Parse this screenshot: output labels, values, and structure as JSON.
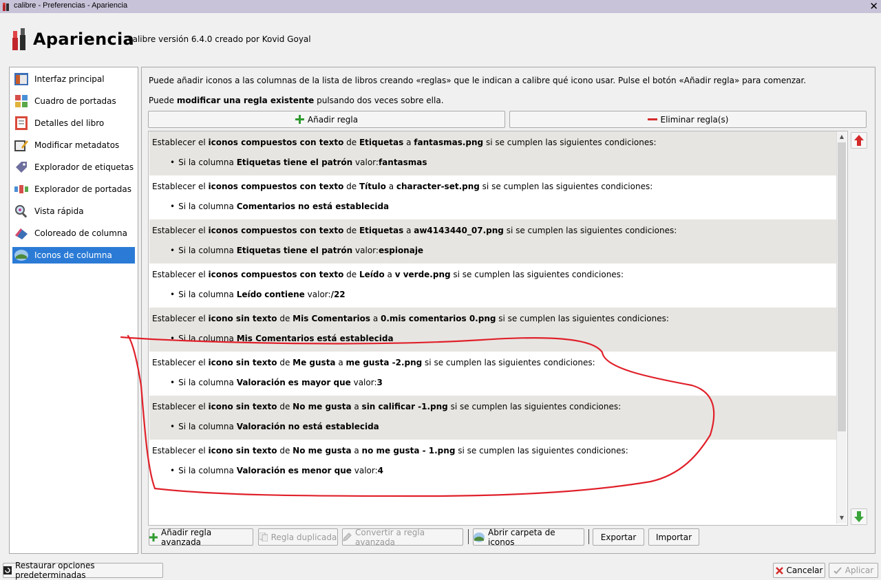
{
  "window": {
    "title": "calibre - Preferencias - Apariencia",
    "close_label": "✕"
  },
  "header": {
    "title": "Apariencia",
    "subtitle": "calibre versión 6.4.0 creado por Kovid Goyal"
  },
  "sidebar": {
    "items": [
      {
        "label": "Interfaz principal",
        "icon": "main-interface-icon"
      },
      {
        "label": "Cuadro de portadas",
        "icon": "cover-grid-icon"
      },
      {
        "label": "Detalles del libro",
        "icon": "book-details-icon"
      },
      {
        "label": "Modificar metadatos",
        "icon": "edit-metadata-icon"
      },
      {
        "label": "Explorador de etiquetas",
        "icon": "tag-browser-icon"
      },
      {
        "label": "Explorador de portadas",
        "icon": "cover-browser-icon"
      },
      {
        "label": "Vista rápida",
        "icon": "quickview-icon"
      },
      {
        "label": "Coloreado de columna",
        "icon": "column-coloring-icon"
      },
      {
        "label": "Iconos de columna",
        "icon": "column-icons-icon"
      }
    ]
  },
  "info": {
    "line1": "Puede añadir iconos a las columnas de la lista de libros creando «reglas» que le indican a calibre qué icono usar. Pulse el botón «Añadir regla» para comenzar.",
    "line2_prefix": "Puede ",
    "line2_bold": "modificar una regla existente",
    "line2_suffix": " pulsando dos veces sobre ella."
  },
  "buttons": {
    "add_rule": "Añadir regla",
    "remove_rules": "Eliminar regla(s)",
    "add_advanced": "Añadir regla avanzada",
    "duplicate": "Regla duplicada",
    "convert": "Convertir a regla avanzada",
    "open_folder": "Abrir carpeta de iconos",
    "export": "Exportar",
    "import": "Importar",
    "restore": "Restaurar opciones predeterminadas",
    "cancel": "Cancelar",
    "apply": "Aplicar"
  },
  "rule_text": {
    "establecer": "Establecer el ",
    "con_texto": "iconos compuestos con texto",
    "sin_texto": "icono sin texto",
    "de": " de ",
    "a": " a ",
    "condiciones": " si se cumplen las siguientes condiciones:",
    "si_columna": "Si la columna ",
    "valor": "valor:"
  },
  "rules": [
    {
      "kind": "con",
      "column": "Etiquetas",
      "file": "fantasmas.png",
      "cond_col": "Etiquetas",
      "cond_op": "tiene el patrón",
      "has_value": true,
      "value": "fantasmas"
    },
    {
      "kind": "con",
      "column": "Título",
      "file": "character-set.png",
      "cond_col": "Comentarios",
      "cond_op": "no está establecida",
      "has_value": false,
      "value": ""
    },
    {
      "kind": "con",
      "column": "Etiquetas",
      "file": "aw4143440_07.png",
      "cond_col": "Etiquetas",
      "cond_op": "tiene el patrón",
      "has_value": true,
      "value": "espionaje"
    },
    {
      "kind": "con",
      "column": "Leído",
      "file": "v verde.png",
      "cond_col": "Leído",
      "cond_op": "contiene",
      "has_value": true,
      "value": "/22"
    },
    {
      "kind": "sin",
      "column": "Mis Comentarios",
      "file": "0.mis comentarios 0.png",
      "cond_col": "Mis Comentarios",
      "cond_op": "está establecida",
      "has_value": false,
      "value": ""
    },
    {
      "kind": "sin",
      "column": "Me gusta",
      "file": "me gusta -2.png",
      "cond_col": "Valoración",
      "cond_op": "es mayor que",
      "has_value": true,
      "value": "3"
    },
    {
      "kind": "sin",
      "column": "No me gusta",
      "file": "sin calificar -1.png",
      "cond_col": "Valoración",
      "cond_op": "no está establecida",
      "has_value": false,
      "value": ""
    },
    {
      "kind": "sin",
      "column": "No me gusta",
      "file": "no me gusta - 1.png",
      "cond_col": "Valoración",
      "cond_op": "es menor que",
      "has_value": true,
      "value": "4"
    }
  ],
  "colors": {
    "accent": "#2b7bd6",
    "annotation": "#e0202a",
    "alt_row": "#e7e5e1"
  }
}
